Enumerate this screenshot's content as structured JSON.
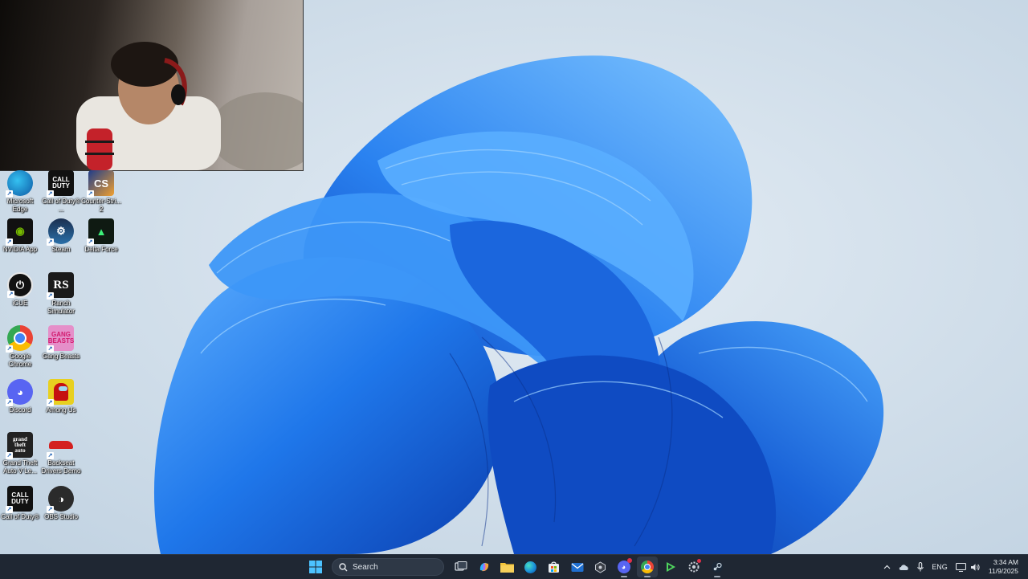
{
  "desktop": {
    "icons": [
      {
        "label": "Microsoft Edge",
        "icon": "edge-icon"
      },
      {
        "label": "Call of Duty® ...",
        "icon": "call-of-duty-icon"
      },
      {
        "label": "Counter-Stri... 2",
        "icon": "counter-strike-icon"
      },
      {
        "label": "NVIDIA App",
        "icon": "nvidia-icon"
      },
      {
        "label": "Steam",
        "icon": "steam-icon"
      },
      {
        "label": "Delta Force",
        "icon": "delta-force-icon"
      },
      {
        "label": "iCUE",
        "icon": "icue-icon"
      },
      {
        "label": "Ranch Simulator",
        "icon": "ranch-simulator-icon"
      },
      {
        "label": "Google Chrome",
        "icon": "chrome-icon"
      },
      {
        "label": "Gang Beasts",
        "icon": "gang-beasts-icon"
      },
      {
        "label": "Discord",
        "icon": "discord-icon"
      },
      {
        "label": "Among Us",
        "icon": "among-us-icon"
      },
      {
        "label": "Grand Theft Auto V Le...",
        "icon": "gta-icon"
      },
      {
        "label": "Backseat Drivers Demo",
        "icon": "backseat-drivers-icon"
      },
      {
        "label": "Call of Duty®",
        "icon": "call-of-duty-icon"
      },
      {
        "label": "OBS Studio",
        "icon": "obs-icon"
      }
    ]
  },
  "taskbar": {
    "search_placeholder": "Search",
    "pinned": [
      "start-icon",
      "task-view-icon",
      "copilot-icon",
      "file-explorer-icon",
      "edge-icon",
      "store-icon",
      "mail-icon",
      "app-icon",
      "discord-icon",
      "chrome-icon",
      "game-launcher-icon",
      "settings-icon",
      "steam-icon"
    ],
    "tray": {
      "language": "ENG",
      "time": "3:34 AM",
      "date": "11/9/2025"
    }
  },
  "colors": {
    "taskbar_bg": "#1f2733",
    "bloom_blue": "#1e6fe0",
    "desktop_bg": "#cfdeea"
  }
}
